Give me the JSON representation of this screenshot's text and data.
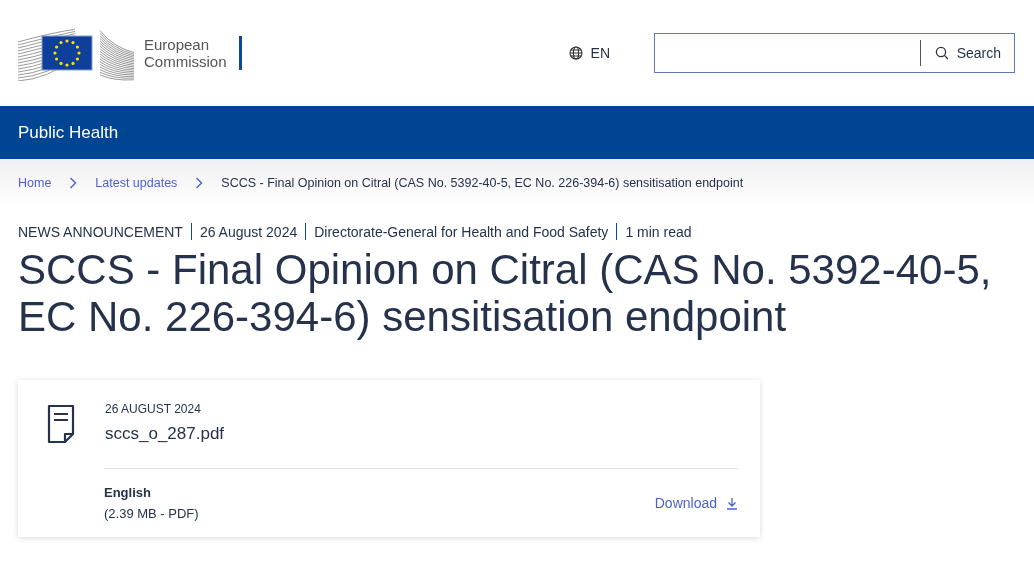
{
  "header": {
    "logo_text_lines": [
      "European",
      "Commission"
    ],
    "language": "EN",
    "search": {
      "button": "Search"
    }
  },
  "site_bar": {
    "title": "Public Health"
  },
  "breadcrumb": [
    {
      "label": "Home",
      "kind": "link"
    },
    {
      "label": "Latest updates",
      "kind": "link"
    },
    {
      "label": "SCCS - Final Opinion on Citral (CAS No. 5392-40-5, EC No. 226-394-6) sensitisation endpoint",
      "kind": "current"
    }
  ],
  "meta": [
    "NEWS ANNOUNCEMENT",
    "26 August 2024",
    "Directorate-General for Health and Food Safety",
    "1 min read"
  ],
  "title": "SCCS - Final Opinion on Citral (CAS No. 5392-40-5, EC No. 226-394-6) sensitisation endpoint",
  "file": {
    "date": "26 AUGUST 2024",
    "name": "sccs_o_287.pdf",
    "language": "English",
    "size": "(2.39 MB - PDF)",
    "action": "Download"
  }
}
